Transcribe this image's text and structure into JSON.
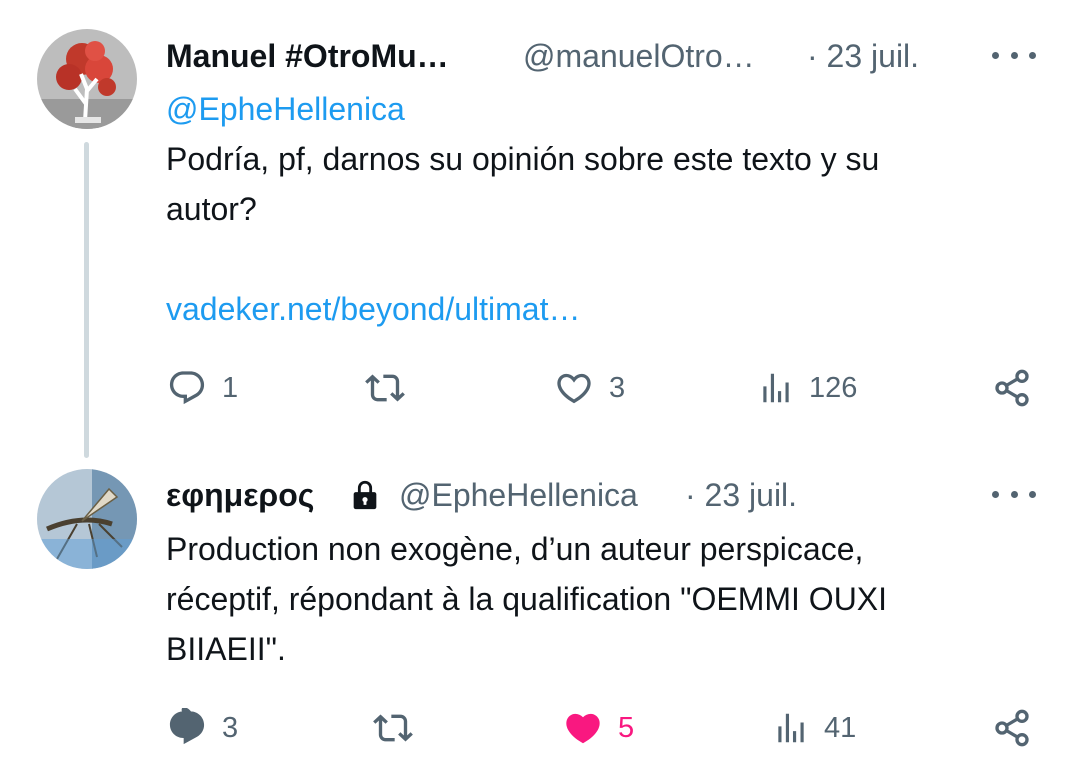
{
  "tweets": [
    {
      "author_name": "Manuel #OtroMu…",
      "handle": "@manuelOtro…",
      "separator_date": "· 23 juil.",
      "mention": "@EpheHellenica",
      "text_line1": "Podría, pf, darnos su opinión sobre este texto y su",
      "text_line2": "autor?",
      "link": "vadeker.net/beyond/ultimat…",
      "replies": "1",
      "retweets": "",
      "likes": "3",
      "views": "126",
      "liked": false,
      "avatar_icon": "bonsai-tree-icon"
    },
    {
      "author_name": "εφημερος",
      "locked_icon": "lock-icon",
      "handle": "@EpheHellenica",
      "separator_date": "· 23 juil.",
      "text_line1": "Production non exogène, d’un auteur perspicace,",
      "text_line2": "réceptif, répondant à la qualification \"OEMMI OUXI",
      "text_line3": "BIIAEII\".",
      "replies": "3",
      "retweets": "",
      "likes": "5",
      "views": "41",
      "liked": true,
      "avatar_icon": "mayfly-icon"
    }
  ],
  "colors": {
    "accent": "#1d9bf0",
    "muted": "#536471",
    "like": "#f91880",
    "thread_line": "#cfd9de"
  }
}
